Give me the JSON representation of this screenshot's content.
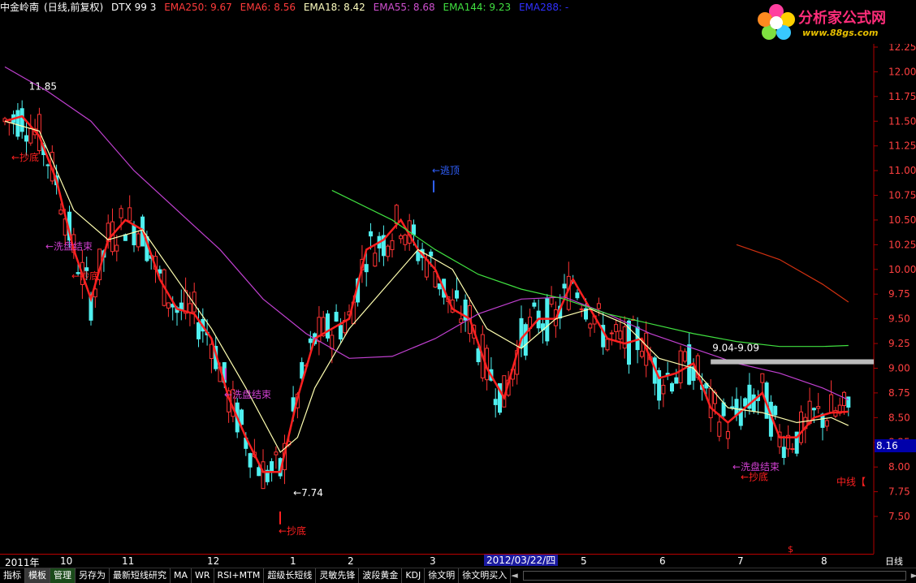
{
  "header": {
    "stock": "中金岭南",
    "mode": "(日线,前复权)",
    "indicator": "DTX 99 3",
    "emas": [
      {
        "label": "EMA250: 9.67",
        "color": "#ff3b3b"
      },
      {
        "label": "EMA6: 8.56",
        "color": "#ff3b3b"
      },
      {
        "label": "EMA18: 8.42",
        "color": "#ffffc0"
      },
      {
        "label": "EMA55: 8.68",
        "color": "#d050d0"
      },
      {
        "label": "EMA144: 9.23",
        "color": "#40e040"
      },
      {
        "label": "EMA288: -",
        "color": "#3030ff"
      }
    ]
  },
  "logo": {
    "name": "分析家公式网",
    "url": "www.88gs.com"
  },
  "current_price": "8.16",
  "x_axis": {
    "year": "2011年",
    "months": [
      "10",
      "11",
      "12",
      "1",
      "2",
      "3",
      "4",
      "5",
      "6",
      "7",
      "8"
    ],
    "date_cursor": "2012/03/22/四",
    "period": "日线"
  },
  "tabs": [
    "指标",
    "模板",
    "管理",
    "另存为",
    "最新短线研究",
    "MA",
    "WR",
    "RSI+MTM",
    "超级长短线",
    "灵敏先锋",
    "波段黄金",
    "KDJ",
    "徐文明",
    "徐文明买入"
  ],
  "annotations": {
    "bottom_buy": "抄底",
    "washout_end": "洗盘结束",
    "escape_top": "逃顶",
    "mid_line": "中线【",
    "high_label": "11.85",
    "low_label": "7.74",
    "band_label": "9.04-9.09",
    "dollar": "$"
  },
  "colors": {
    "up": "#ff3333",
    "down": "#4ff0f0",
    "ema6": "#ff2020",
    "ema18": "#ffffb0",
    "ema55": "#c040d0",
    "ema144": "#40e040",
    "ema250": "#d03010",
    "axis": "#b00000"
  },
  "chart_data": {
    "type": "line",
    "title": "中金岭南 (日线,前复权)",
    "ylim": [
      7.35,
      12.3
    ],
    "yticks": [
      7.5,
      7.75,
      8.0,
      8.25,
      8.5,
      8.75,
      9.0,
      9.25,
      9.5,
      9.75,
      10.0,
      10.25,
      10.5,
      10.75,
      11.0,
      11.25,
      11.5,
      11.75,
      12.0,
      12.25
    ],
    "x_range": [
      0,
      100
    ],
    "series": [
      {
        "name": "EMA6",
        "x": [
          0,
          2,
          4,
          6,
          8,
          10,
          12,
          14,
          16,
          18,
          20,
          22,
          24,
          26,
          28,
          30,
          32,
          34,
          36,
          38,
          40,
          42,
          44,
          46,
          48,
          50,
          52,
          54,
          56,
          58,
          60,
          62,
          64,
          66,
          68,
          70,
          72,
          74,
          76,
          78,
          80,
          82,
          84,
          86,
          88,
          90,
          92,
          94,
          96,
          98
        ],
        "values": [
          11.5,
          11.55,
          11.35,
          10.9,
          10.2,
          9.7,
          10.3,
          10.5,
          10.4,
          9.9,
          9.6,
          9.55,
          9.3,
          8.7,
          8.3,
          7.95,
          7.95,
          8.7,
          9.3,
          9.4,
          9.5,
          10.2,
          10.3,
          10.5,
          10.2,
          10.0,
          9.6,
          9.5,
          9.0,
          8.7,
          9.3,
          9.5,
          9.5,
          9.9,
          9.6,
          9.3,
          9.25,
          9.3,
          8.9,
          8.95,
          9.05,
          8.6,
          8.45,
          8.6,
          8.75,
          8.3,
          8.3,
          8.5,
          8.55,
          8.56
        ]
      },
      {
        "name": "EMA18",
        "x": [
          0,
          4,
          8,
          12,
          16,
          20,
          24,
          28,
          32,
          34,
          36,
          40,
          44,
          48,
          52,
          56,
          60,
          64,
          68,
          72,
          76,
          80,
          84,
          88,
          92,
          96,
          98
        ],
        "values": [
          11.5,
          11.4,
          10.6,
          10.3,
          10.4,
          9.9,
          9.4,
          8.8,
          8.15,
          8.3,
          8.8,
          9.4,
          9.8,
          10.2,
          10.0,
          9.4,
          9.2,
          9.5,
          9.6,
          9.45,
          9.1,
          9.0,
          8.6,
          8.55,
          8.45,
          8.5,
          8.42
        ]
      },
      {
        "name": "EMA55",
        "x": [
          0,
          5,
          10,
          15,
          20,
          25,
          30,
          35,
          40,
          45,
          50,
          55,
          60,
          65,
          70,
          75,
          80,
          85,
          90,
          95,
          98
        ],
        "values": [
          12.05,
          11.8,
          11.5,
          11.0,
          10.6,
          10.2,
          9.7,
          9.35,
          9.1,
          9.12,
          9.3,
          9.55,
          9.7,
          9.72,
          9.55,
          9.35,
          9.2,
          9.05,
          8.95,
          8.8,
          8.68
        ]
      },
      {
        "name": "EMA144",
        "x": [
          38,
          45,
          50,
          55,
          60,
          65,
          70,
          75,
          80,
          85,
          90,
          95,
          98
        ],
        "values": [
          10.8,
          10.5,
          10.2,
          9.95,
          9.8,
          9.7,
          9.55,
          9.45,
          9.35,
          9.27,
          9.22,
          9.22,
          9.23
        ]
      },
      {
        "name": "EMA250",
        "x": [
          85,
          90,
          95,
          98
        ],
        "values": [
          10.25,
          10.1,
          9.85,
          9.67
        ]
      }
    ]
  }
}
